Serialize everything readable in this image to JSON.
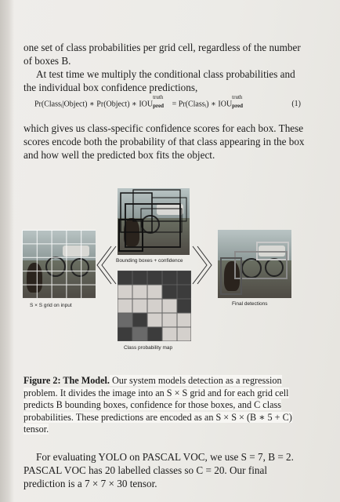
{
  "paragraphs": {
    "p1": "one set of class probabilities per grid cell, regardless of the number of boxes B.",
    "p2": "At test time we multiply the conditional class probabilities and the individual box confidence predictions,",
    "p3": "which gives us class-specific confidence scores for each box. These scores encode both the probability of that class appearing in the box and how well the predicted box fits the object."
  },
  "equation": {
    "lhs": "Pr(Classᵢ|Object) ∗ Pr(Object) ∗ IOU",
    "rhs": "= Pr(Classᵢ) ∗ IOU",
    "sup": "truth",
    "sub": "pred",
    "number": "(1)"
  },
  "figure": {
    "label_grid": "S × S grid on input",
    "label_boxes": "Bounding boxes + confidence",
    "label_final": "Final detections",
    "label_map": "Class probability map"
  },
  "caption": {
    "head": "Figure 2: The Model.",
    "body": " Our system models detection as a regression problem. It divides the image into an S × S grid and for each grid cell predicts B bounding boxes, confidence for those boxes, and C class probabilities. These predictions are encoded as an S × S × (B ∗ 5 + C) tensor."
  },
  "final": {
    "p4": "For evaluating YOLO on PASCAL VOC, we use S = 7, B = 2. PASCAL VOC has 20 labelled classes so C = 20. Our final prediction is a 7 × 7 × 30 tensor."
  }
}
